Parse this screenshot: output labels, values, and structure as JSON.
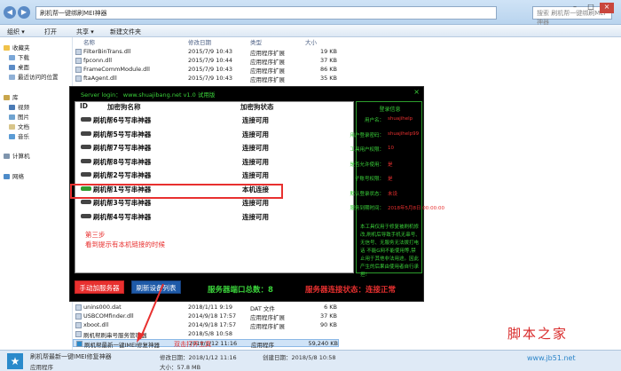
{
  "titlebar": {
    "path": "刷机帮一键绑刷MEI神器",
    "search": "搜索 刷机帮一键绑刷MEI神器"
  },
  "toolbar": {
    "organize": "组织 ▾",
    "open": "打开",
    "share": "共享 ▾",
    "new_folder": "新建文件夹"
  },
  "sidebar": {
    "items": [
      {
        "label": "收藏夹"
      },
      {
        "label": "下载"
      },
      {
        "label": "桌面"
      },
      {
        "label": "最近访问的位置"
      },
      {
        "label": "库"
      },
      {
        "label": "视频"
      },
      {
        "label": "图片"
      },
      {
        "label": "文档"
      },
      {
        "label": "音乐"
      },
      {
        "label": "计算机"
      },
      {
        "label": "网络"
      }
    ]
  },
  "filelist": {
    "headers": {
      "name": "名称",
      "date": "修改日期",
      "type": "类型",
      "size": "大小"
    },
    "top_rows": [
      {
        "name": "FilterBinTrans.dll",
        "date": "2015/7/9 10:43",
        "type": "应用程序扩展",
        "size": "19 KB"
      },
      {
        "name": "fpconn.dll",
        "date": "2015/7/9 10:44",
        "type": "应用程序扩展",
        "size": "37 KB"
      },
      {
        "name": "FrameCommModule.dll",
        "date": "2015/7/9 10:43",
        "type": "应用程序扩展",
        "size": "86 KB"
      },
      {
        "name": "ftaAgent.dll",
        "date": "2015/7/9 10:43",
        "type": "应用程序扩展",
        "size": "35 KB"
      }
    ],
    "bottom_rows": [
      {
        "name": "unins000.dat",
        "date": "2018/1/11 9:19",
        "type": "DAT 文件",
        "size": "6 KB"
      },
      {
        "name": "USBCOMfinder.dll",
        "date": "2014/9/18 17:57",
        "type": "应用程序扩展",
        "size": "37 KB"
      },
      {
        "name": "xboot.dll",
        "date": "2014/9/18 17:57",
        "type": "应用程序扩展",
        "size": "90 KB"
      },
      {
        "name": "刷机帮刷串号服务管理器",
        "date": "2018/5/8 10:58",
        "type": "",
        "size": ""
      },
      {
        "name": "刷机帮最新一键IMEI修复神器",
        "date": "2018/1/12 11:16",
        "type": "应用程序",
        "size": "59,240 KB"
      }
    ]
  },
  "app": {
    "title": "Server login： www.shuajibang.net v1.0 试用版",
    "close": "×",
    "table_headers": {
      "id": "ID",
      "name": "加密狗名称",
      "status": "加密狗状态"
    },
    "devices": [
      {
        "name": "刷机帮6号写串神器",
        "status": "连接可用",
        "local": false
      },
      {
        "name": "刷机帮5号写串神器",
        "status": "连接可用",
        "local": false
      },
      {
        "name": "刷机帮7号写串神器",
        "status": "连接可用",
        "local": false
      },
      {
        "name": "刷机帮8号写串神器",
        "status": "连接可用",
        "local": false
      },
      {
        "name": "刷机帮2号写串神器",
        "status": "连接可用",
        "local": false
      },
      {
        "name": "刷机帮1号写串神器",
        "status": "本机连接",
        "local": true
      },
      {
        "name": "刷机帮3号写串神器",
        "status": "连接可用",
        "local": false
      },
      {
        "name": "刷机帮4号写串神器",
        "status": "连接可用",
        "local": false
      }
    ],
    "info_title": "登录信息",
    "info": [
      {
        "label": "用户名：",
        "value": "shuajihelp"
      },
      {
        "label": "用户登录密码：",
        "value": "shuajihelp99"
      },
      {
        "label": "工具用户权限：",
        "value": "10"
      },
      {
        "label": "是否允许使用：",
        "value": "是"
      },
      {
        "label": "子账号权限：",
        "value": "是"
      },
      {
        "label": "默认登录状态：",
        "value": "未设"
      },
      {
        "label": "服务到期时间：",
        "value": "2018年5月8日 00:00:00"
      }
    ],
    "info_notes": "本工具仅用于修复被刷机修改,刷机后导致手机无串号、无信号、无服务无法拨打电话 不能G网不能使用等,禁止用于其他非法用途。因此产生的后果由使用者自行承担！",
    "btn_manual": "手动加服务器",
    "btn_refresh": "刷新设备列表",
    "port_count": "服务器端口总数：8",
    "conn_state": "服务器连接状态：连接正常",
    "note_line1": "第三步",
    "note_line2": "看到提示有本机链接的时候"
  },
  "annotation": {
    "double_click": "双击打开工具"
  },
  "statusbar": {
    "name": "刷机帮最新一键IMEI修复神器",
    "modified": "修改日期：2018/1/12 11:16",
    "created": "创建日期：2018/5/8 10:58",
    "type": "应用程序",
    "size": "大小：57.8 MB"
  },
  "watermark": {
    "title": "脚本之家",
    "url": "www.jb51.net"
  }
}
